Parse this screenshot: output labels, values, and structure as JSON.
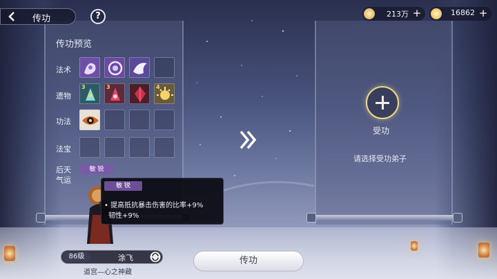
{
  "topbar": {
    "title": "传功",
    "help_label": "?",
    "resources": [
      {
        "icon": "coin-icon",
        "value": "213万",
        "plus": "+"
      },
      {
        "icon": "gourd-icon",
        "value": "16862",
        "plus": "+"
      }
    ]
  },
  "left_panel": {
    "title": "传功预览",
    "rows": [
      {
        "key": "spells",
        "label": "法术"
      },
      {
        "key": "relics",
        "label": "遗物"
      },
      {
        "key": "techniques",
        "label": "功法"
      },
      {
        "key": "treasures",
        "label": "法宝"
      },
      {
        "key": "fortune",
        "label_line1": "后天",
        "label_line2": "气运"
      }
    ],
    "spell_slots": [
      "spirit-hand-spell-icon",
      "vortex-spell-icon",
      "crane-spell-icon",
      "empty"
    ],
    "relic_slots": [
      {
        "icon": "relic-sword-teal-icon",
        "level": "3"
      },
      {
        "icon": "relic-sword-crimson-icon",
        "level": "3"
      },
      {
        "icon": "relic-red-crystal-icon",
        "level": ""
      },
      {
        "icon": "relic-golden-sun-icon",
        "level": "4"
      }
    ],
    "technique_slots": [
      "eye-technique-icon",
      "empty",
      "empty",
      "empty"
    ],
    "treasure_slots": [
      "empty",
      "empty",
      "empty",
      "empty"
    ],
    "fortune_tag": "敏 锐"
  },
  "tooltip": {
    "tag": "敏 锐",
    "line1": "• 提高抵抗暴击伤害的比率+9%",
    "line2": "韧性+9%"
  },
  "right_panel": {
    "add_label": "受功",
    "hint": "请选择受功弟子"
  },
  "character": {
    "level": "86级",
    "name": "涂飞",
    "title": "道宫—心之神藏"
  },
  "actions": {
    "transfer_label": "传功"
  },
  "colors": {
    "accent_gold": "#f2d888",
    "tag_purple": "#7a5aa8"
  }
}
